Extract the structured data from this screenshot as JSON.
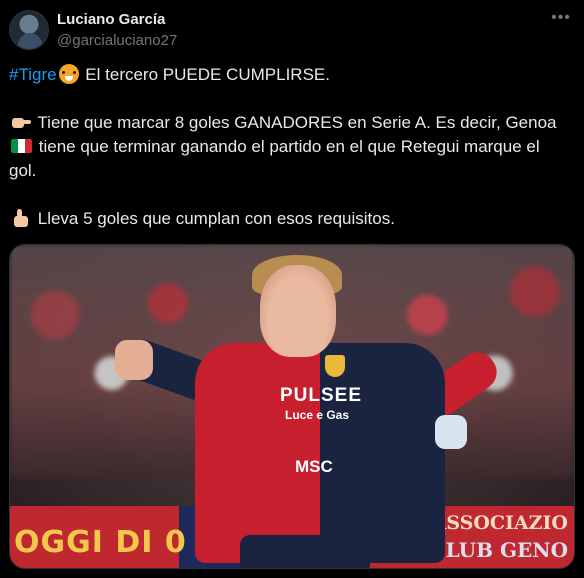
{
  "author": {
    "name": "Luciano García",
    "handle": "@garcialuciano27",
    "avatar_icon": "avatar-photo"
  },
  "menu_icon": "more-dots-icon",
  "tweet": {
    "line1": {
      "hashtag": "#Tigre",
      "emoji": "tiger-face-icon",
      "text": "El tercero PUEDE CUMPLIRSE."
    },
    "line2": {
      "emoji": "pointing-right-icon",
      "text_a": "Tiene que marcar 8 goles GANADORES en Serie A. Es decir, Genoa",
      "flag": "italy-flag-icon",
      "text_b": "tiene que terminar ganando el partido en el que Retegui marque el",
      "text_c": "gol."
    },
    "line3": {
      "emoji": "thumbs-up-icon",
      "text": "Lleva 5 goles que cumplan con esos requisitos."
    }
  },
  "media": {
    "jersey_sponsor": "PULSEE",
    "jersey_sponsor_sub": "Luce e Gas",
    "jersey_sponsor_2": "MSC",
    "banner_left": "OGGI DI 0",
    "banner_right_1": "ASSOCIAZIO",
    "banner_right_2": "CLUB GENO"
  },
  "colors": {
    "background": "#000000",
    "text": "#e7e9ea",
    "secondary": "#71767b",
    "hashtag": "#1d9bf0"
  }
}
